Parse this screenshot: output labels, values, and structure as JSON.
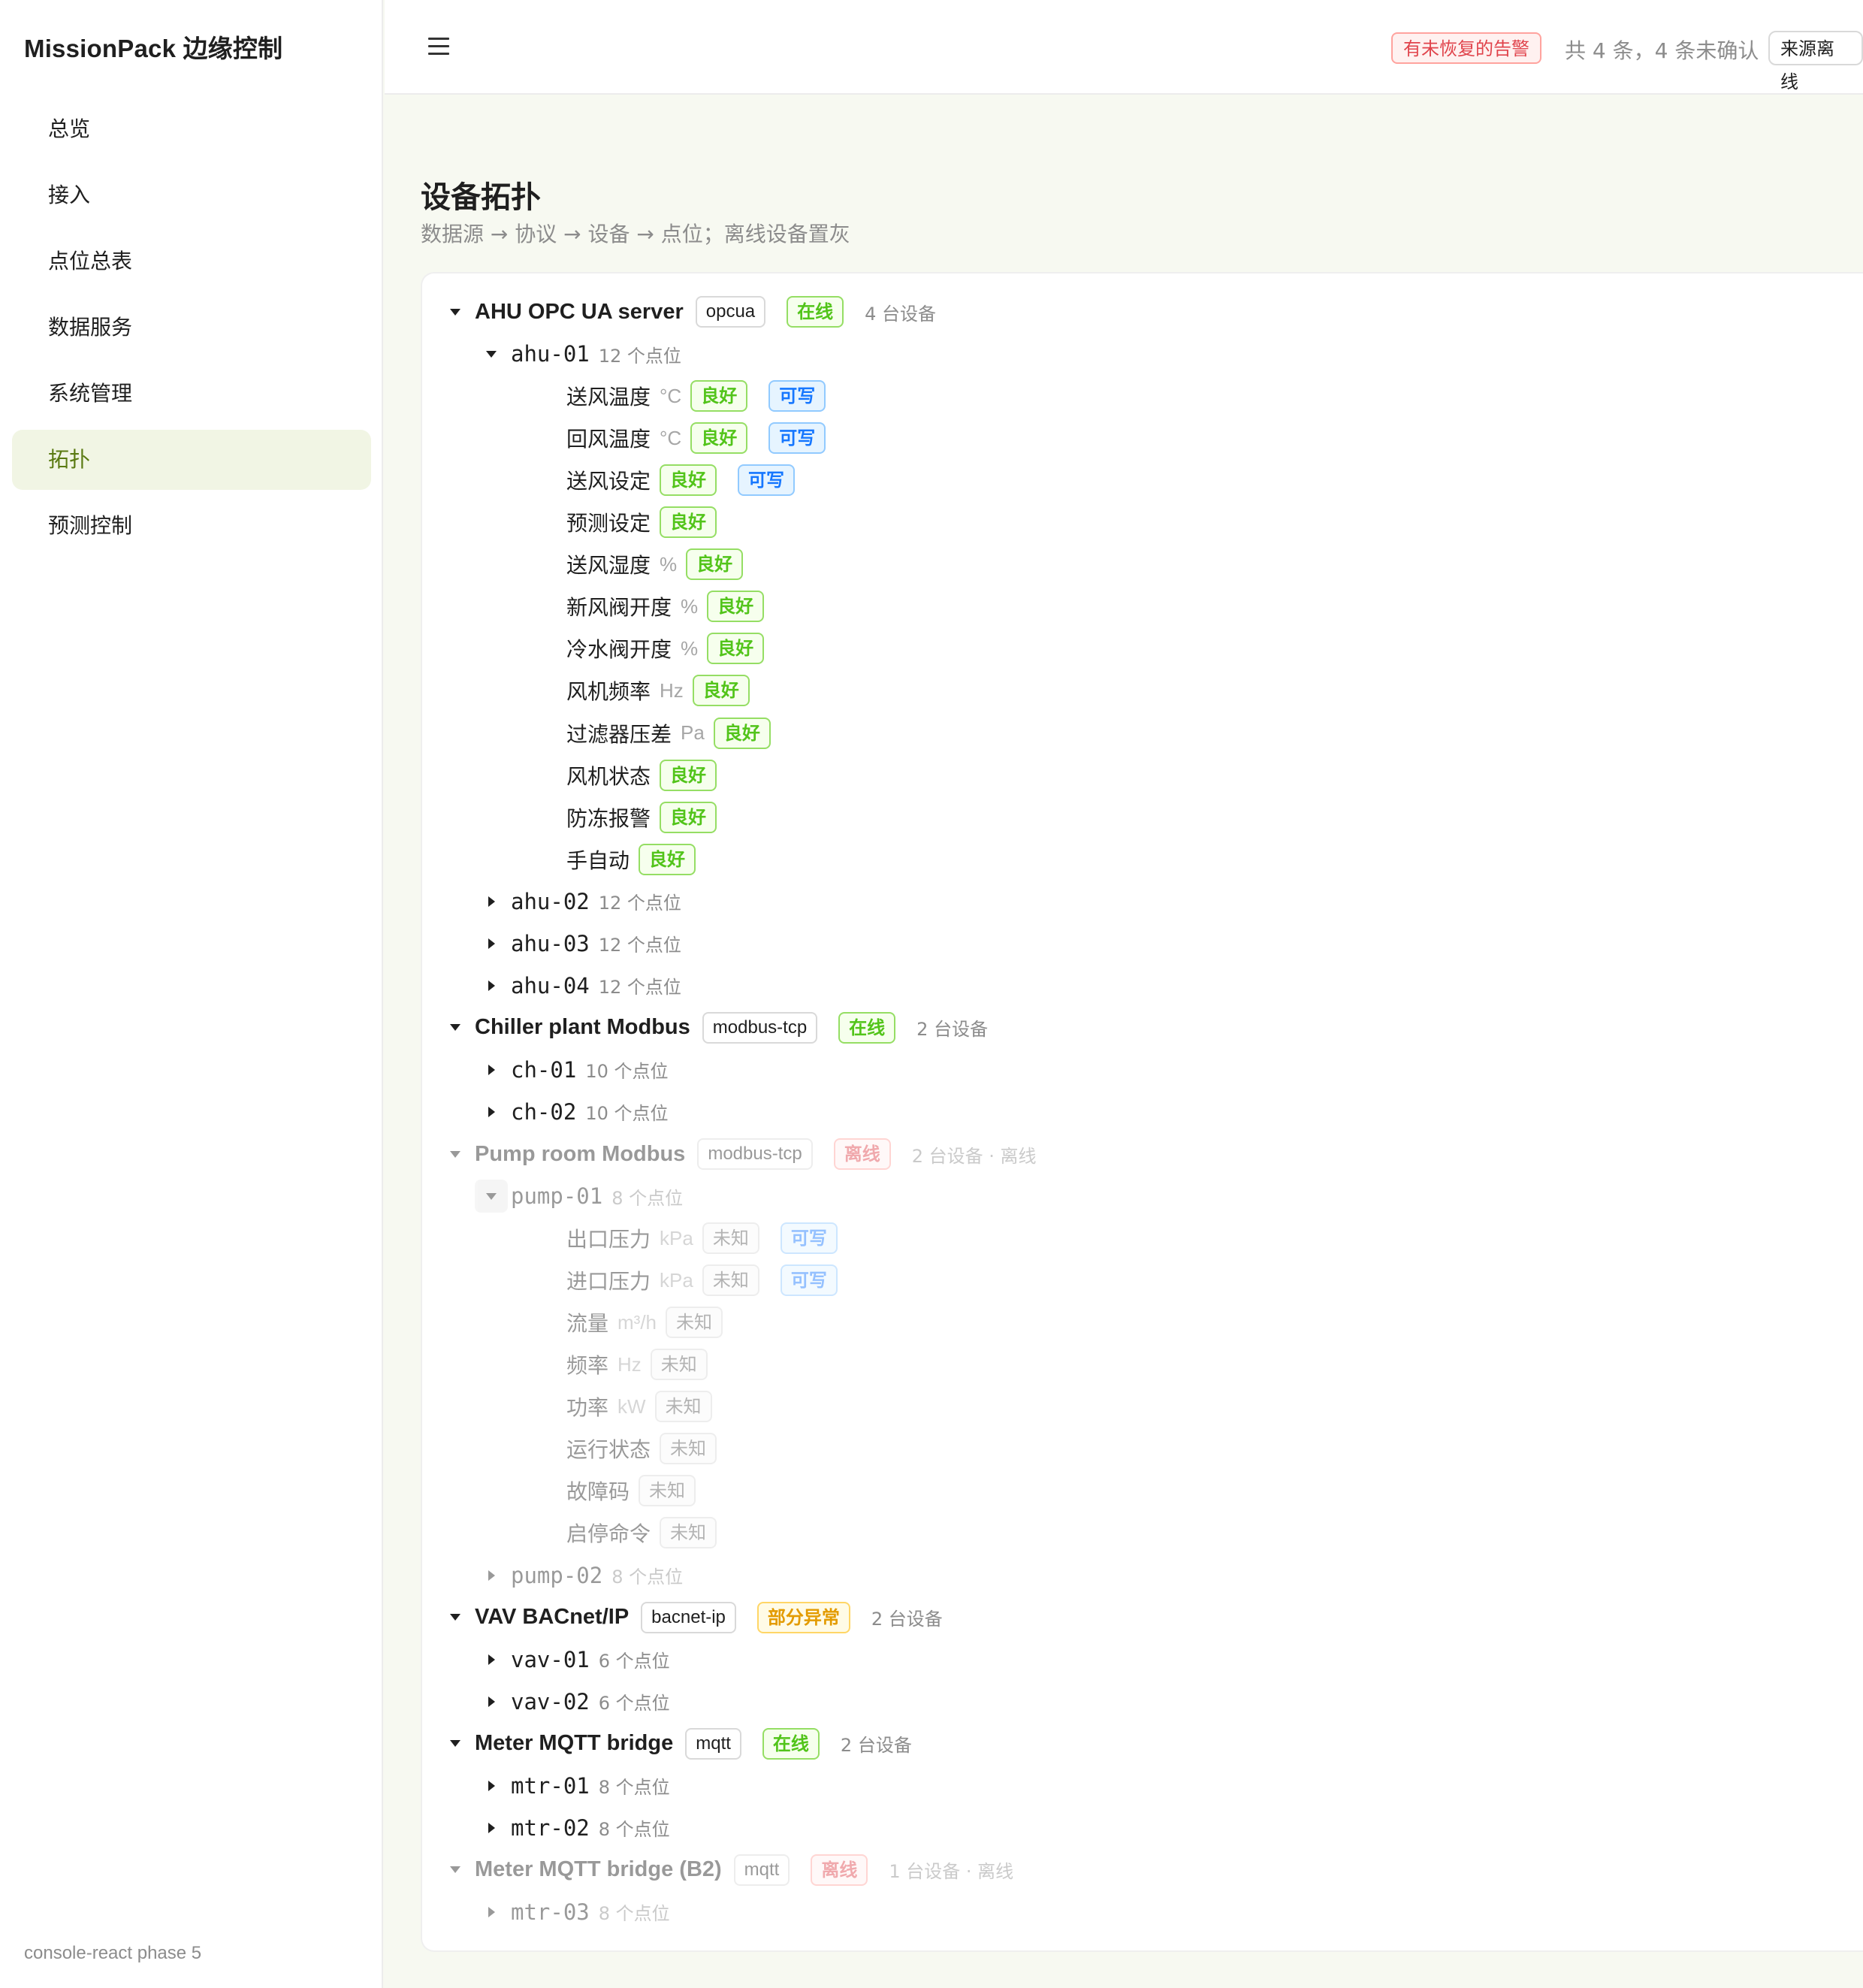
{
  "sidebar": {
    "brand": "MissionPack 边缘控制",
    "items": [
      {
        "label": "总览"
      },
      {
        "label": "接入"
      },
      {
        "label": "点位总表"
      },
      {
        "label": "数据服务"
      },
      {
        "label": "系统管理"
      },
      {
        "label": "拓扑",
        "active": true
      },
      {
        "label": "预测控制"
      }
    ],
    "footer": "console-react phase 5"
  },
  "topbar": {
    "alarm_tag": "有未恢复的告警",
    "alarm_text": "共 4 条，4 条未确认",
    "source_offline_button": "来源离线"
  },
  "page": {
    "title": "设备拓扑",
    "subtitle": "数据源 → 协议 → 设备 → 点位；离线设备置灰"
  },
  "colors": {
    "accent": "#5a7a12",
    "good": "#52c41a",
    "writable": "#1677ff",
    "offline": "#e0434b",
    "partial": "#e39b00"
  },
  "tree": [
    {
      "type": "source",
      "expanded": true,
      "name": "AHU OPC UA server",
      "protocol": "opcua",
      "status": "在线",
      "status_kind": "green",
      "count": "4 台设备",
      "offline": false
    },
    {
      "type": "device",
      "expanded": true,
      "name": "ahu-01",
      "count": "12 个点位",
      "offline": false
    },
    {
      "type": "point",
      "name": "送风温度",
      "unit": "°C",
      "quality": "良好",
      "quality_kind": "green",
      "writable": "可写",
      "offline": false
    },
    {
      "type": "point",
      "name": "回风温度",
      "unit": "°C",
      "quality": "良好",
      "quality_kind": "green",
      "writable": "可写",
      "offline": false
    },
    {
      "type": "point",
      "name": "送风设定",
      "unit": "",
      "quality": "良好",
      "quality_kind": "green",
      "writable": "可写",
      "offline": false
    },
    {
      "type": "point",
      "name": "预测设定",
      "unit": "",
      "quality": "良好",
      "quality_kind": "green",
      "offline": false
    },
    {
      "type": "point",
      "name": "送风湿度",
      "unit": "%",
      "quality": "良好",
      "quality_kind": "green",
      "offline": false
    },
    {
      "type": "point",
      "name": "新风阀开度",
      "unit": "%",
      "quality": "良好",
      "quality_kind": "green",
      "offline": false
    },
    {
      "type": "point",
      "name": "冷水阀开度",
      "unit": "%",
      "quality": "良好",
      "quality_kind": "green",
      "offline": false
    },
    {
      "type": "point",
      "name": "风机频率",
      "unit": "Hz",
      "quality": "良好",
      "quality_kind": "green",
      "offline": false
    },
    {
      "type": "point",
      "name": "过滤器压差",
      "unit": "Pa",
      "quality": "良好",
      "quality_kind": "green",
      "offline": false
    },
    {
      "type": "point",
      "name": "风机状态",
      "unit": "",
      "quality": "良好",
      "quality_kind": "green",
      "offline": false
    },
    {
      "type": "point",
      "name": "防冻报警",
      "unit": "",
      "quality": "良好",
      "quality_kind": "green",
      "offline": false
    },
    {
      "type": "point",
      "name": "手自动",
      "unit": "",
      "quality": "良好",
      "quality_kind": "green",
      "offline": false
    },
    {
      "type": "device",
      "expanded": false,
      "name": "ahu-02",
      "count": "12 个点位",
      "offline": false
    },
    {
      "type": "device",
      "expanded": false,
      "name": "ahu-03",
      "count": "12 个点位",
      "offline": false
    },
    {
      "type": "device",
      "expanded": false,
      "name": "ahu-04",
      "count": "12 个点位",
      "offline": false
    },
    {
      "type": "source",
      "expanded": true,
      "name": "Chiller plant Modbus",
      "protocol": "modbus-tcp",
      "status": "在线",
      "status_kind": "green",
      "count": "2 台设备",
      "offline": false
    },
    {
      "type": "device",
      "expanded": false,
      "name": "ch-01",
      "count": "10 个点位",
      "offline": false
    },
    {
      "type": "device",
      "expanded": false,
      "name": "ch-02",
      "count": "10 个点位",
      "offline": false
    },
    {
      "type": "source",
      "expanded": true,
      "name": "Pump room Modbus",
      "protocol": "modbus-tcp",
      "status": "离线",
      "status_kind": "red",
      "count": "2 台设备 · 离线",
      "offline": true
    },
    {
      "type": "device",
      "expanded": true,
      "name": "pump-01",
      "count": "8 个点位",
      "offline": true,
      "focused": true
    },
    {
      "type": "point",
      "name": "出口压力",
      "unit": "kPa",
      "quality": "未知",
      "quality_kind": "gray",
      "writable": "可写",
      "offline": true
    },
    {
      "type": "point",
      "name": "进口压力",
      "unit": "kPa",
      "quality": "未知",
      "quality_kind": "gray",
      "writable": "可写",
      "offline": true
    },
    {
      "type": "point",
      "name": "流量",
      "unit": "m³/h",
      "quality": "未知",
      "quality_kind": "gray",
      "offline": true
    },
    {
      "type": "point",
      "name": "频率",
      "unit": "Hz",
      "quality": "未知",
      "quality_kind": "gray",
      "offline": true
    },
    {
      "type": "point",
      "name": "功率",
      "unit": "kW",
      "quality": "未知",
      "quality_kind": "gray",
      "offline": true
    },
    {
      "type": "point",
      "name": "运行状态",
      "unit": "",
      "quality": "未知",
      "quality_kind": "gray",
      "offline": true
    },
    {
      "type": "point",
      "name": "故障码",
      "unit": "",
      "quality": "未知",
      "quality_kind": "gray",
      "offline": true
    },
    {
      "type": "point",
      "name": "启停命令",
      "unit": "",
      "quality": "未知",
      "quality_kind": "gray",
      "offline": true
    },
    {
      "type": "device",
      "expanded": false,
      "name": "pump-02",
      "count": "8 个点位",
      "offline": true
    },
    {
      "type": "source",
      "expanded": true,
      "name": "VAV BACnet/IP",
      "protocol": "bacnet-ip",
      "status": "部分异常",
      "status_kind": "orange",
      "count": "2 台设备",
      "offline": false
    },
    {
      "type": "device",
      "expanded": false,
      "name": "vav-01",
      "count": "6 个点位",
      "offline": false
    },
    {
      "type": "device",
      "expanded": false,
      "name": "vav-02",
      "count": "6 个点位",
      "offline": false
    },
    {
      "type": "source",
      "expanded": true,
      "name": "Meter MQTT bridge",
      "protocol": "mqtt",
      "status": "在线",
      "status_kind": "green",
      "count": "2 台设备",
      "offline": false
    },
    {
      "type": "device",
      "expanded": false,
      "name": "mtr-01",
      "count": "8 个点位",
      "offline": false
    },
    {
      "type": "device",
      "expanded": false,
      "name": "mtr-02",
      "count": "8 个点位",
      "offline": false
    },
    {
      "type": "source",
      "expanded": true,
      "name": "Meter MQTT bridge (B2)",
      "protocol": "mqtt",
      "status": "离线",
      "status_kind": "red",
      "count": "1 台设备 · 离线",
      "offline": true
    },
    {
      "type": "device",
      "expanded": false,
      "name": "mtr-03",
      "count": "8 个点位",
      "offline": true
    }
  ]
}
